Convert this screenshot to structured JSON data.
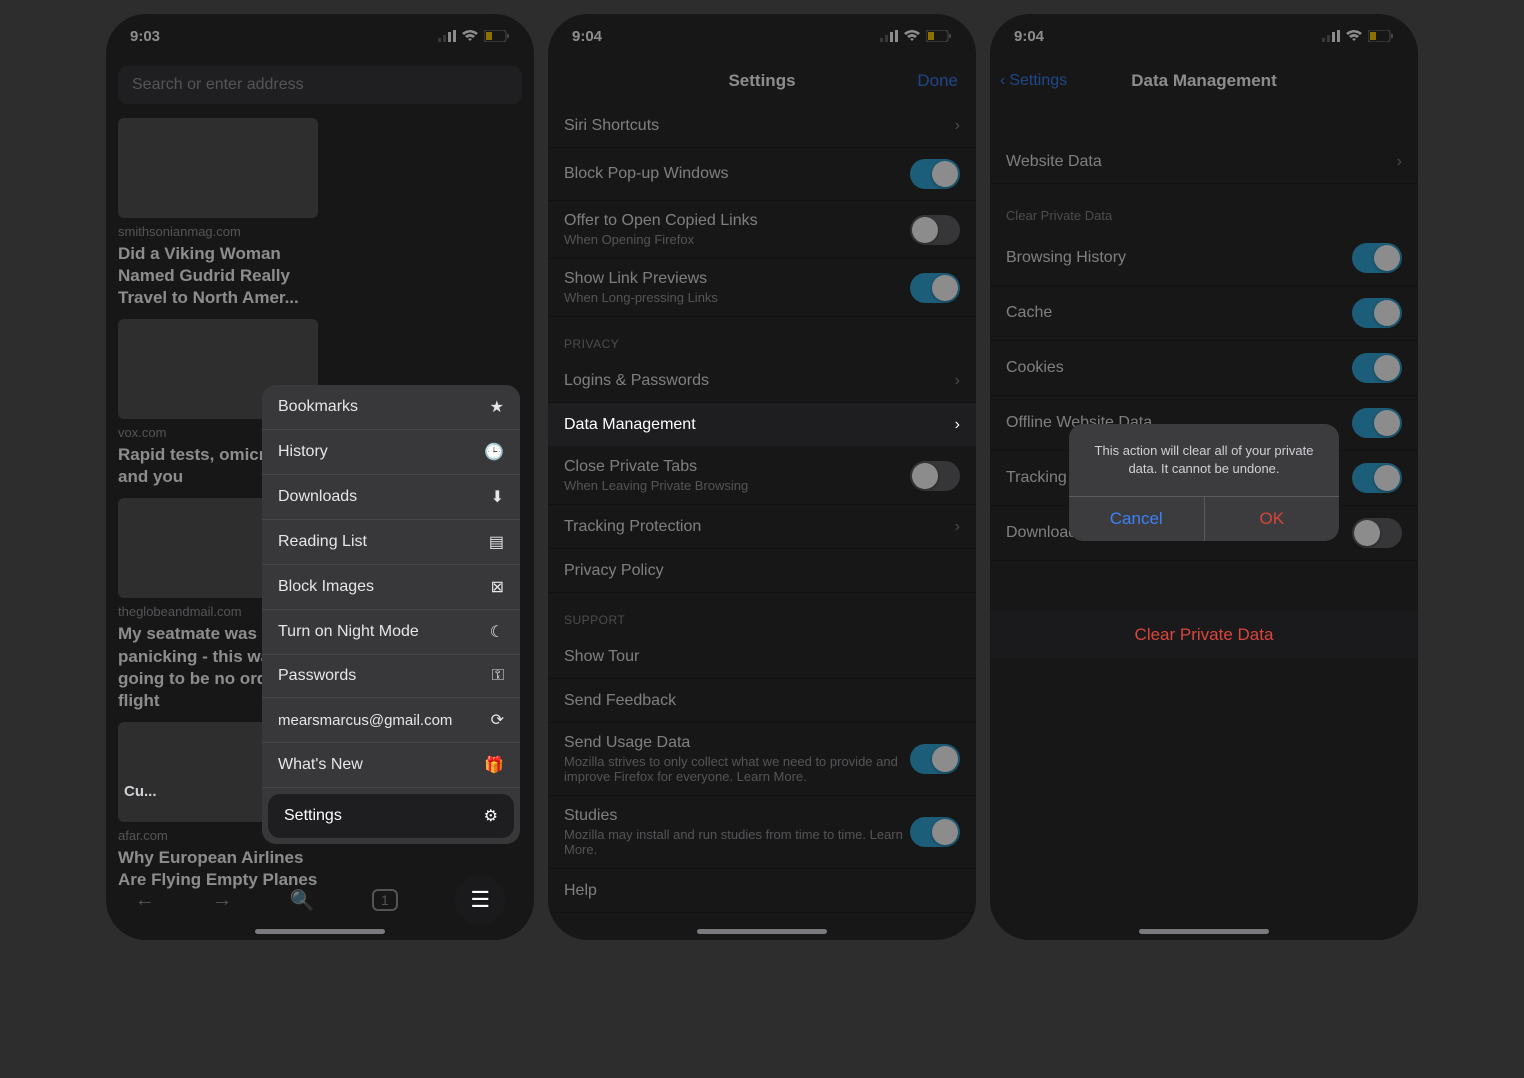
{
  "status": {
    "time1": "9:03",
    "time2": "9:04",
    "time3": "9:04"
  },
  "screen1": {
    "search_placeholder": "Search or enter address",
    "cards": [
      {
        "domain": "smithsonianmag.com",
        "title": "Did a Viking Woman Named Gudrid Really Travel to North Amer..."
      },
      {
        "domain": "vox.com",
        "title": "Rapid tests, omicron, and you"
      },
      {
        "domain": "theglobeandmail.com",
        "title": "My seatmate was panicking - this was going to be no ordinary flight"
      },
      {
        "domain": "afar.com",
        "title": "Why European Airlines Are Flying Empty Planes"
      }
    ],
    "customize": "Cu...",
    "tab_count": "1",
    "menu": {
      "bookmarks": "Bookmarks",
      "history": "History",
      "downloads": "Downloads",
      "reading_list": "Reading List",
      "block_images": "Block Images",
      "night_mode": "Turn on Night Mode",
      "passwords": "Passwords",
      "account": "mearsmarcus@gmail.com",
      "whats_new": "What's New",
      "settings": "Settings"
    }
  },
  "screen2": {
    "title": "Settings",
    "done": "Done",
    "siri": "Siri Shortcuts",
    "popup": "Block Pop-up Windows",
    "copied": "Offer to Open Copied Links",
    "copied_sub": "When Opening Firefox",
    "previews": "Show Link Previews",
    "previews_sub": "When Long-pressing Links",
    "privacy_header": "PRIVACY",
    "logins": "Logins & Passwords",
    "data_mgmt": "Data Management",
    "close_private": "Close Private Tabs",
    "close_private_sub": "When Leaving Private Browsing",
    "tracking": "Tracking Protection",
    "privacy_policy": "Privacy Policy",
    "support_header": "SUPPORT",
    "show_tour": "Show Tour",
    "feedback": "Send Feedback",
    "usage": "Send Usage Data",
    "usage_sub": "Mozilla strives to only collect what we need to provide and improve Firefox for everyone. Learn More.",
    "studies": "Studies",
    "studies_sub": "Mozilla may install and run studies from time to time. Learn More.",
    "help": "Help"
  },
  "screen3": {
    "back": "Settings",
    "title": "Data Management",
    "website_data": "Website Data",
    "section": "Clear Private Data",
    "items": {
      "browsing": "Browsing History",
      "cache": "Cache",
      "cookies": "Cookies",
      "offline": "Offline Website Data",
      "tracking": "Tracking Protection",
      "downloaded": "Downloaded Files"
    },
    "clear_btn": "Clear Private Data",
    "alert_text": "This action will clear all of your private data. It cannot be undone.",
    "alert_cancel": "Cancel",
    "alert_ok": "OK"
  }
}
